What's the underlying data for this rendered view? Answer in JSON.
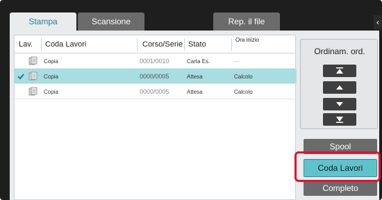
{
  "tabs": {
    "print": "Stampa",
    "scan": "Scansione",
    "file": "Rep. il file"
  },
  "columns": {
    "lav": "Lav.",
    "queue": "Coda Lavori",
    "copies": "Corso/Serie",
    "status": "Stato",
    "start": "Ora inizio"
  },
  "rows": [
    {
      "name": "Copia",
      "copies": "0001/0010",
      "status": "Carta Es.",
      "start": "---",
      "selected": false
    },
    {
      "name": "Copia",
      "copies": "0000/0005",
      "status": "Attesa",
      "start": "Calcolo",
      "selected": true
    },
    {
      "name": "Copia",
      "copies": "0000/0005",
      "status": "Attesa",
      "start": "Calcolo",
      "selected": false
    }
  ],
  "sidebar": {
    "title": "Ordinam. ord."
  },
  "buttons": {
    "spool": "Spool",
    "queue": "Coda Lavori",
    "complete": "Completo"
  },
  "icons": {
    "collapse": "chevron-left-icon"
  }
}
